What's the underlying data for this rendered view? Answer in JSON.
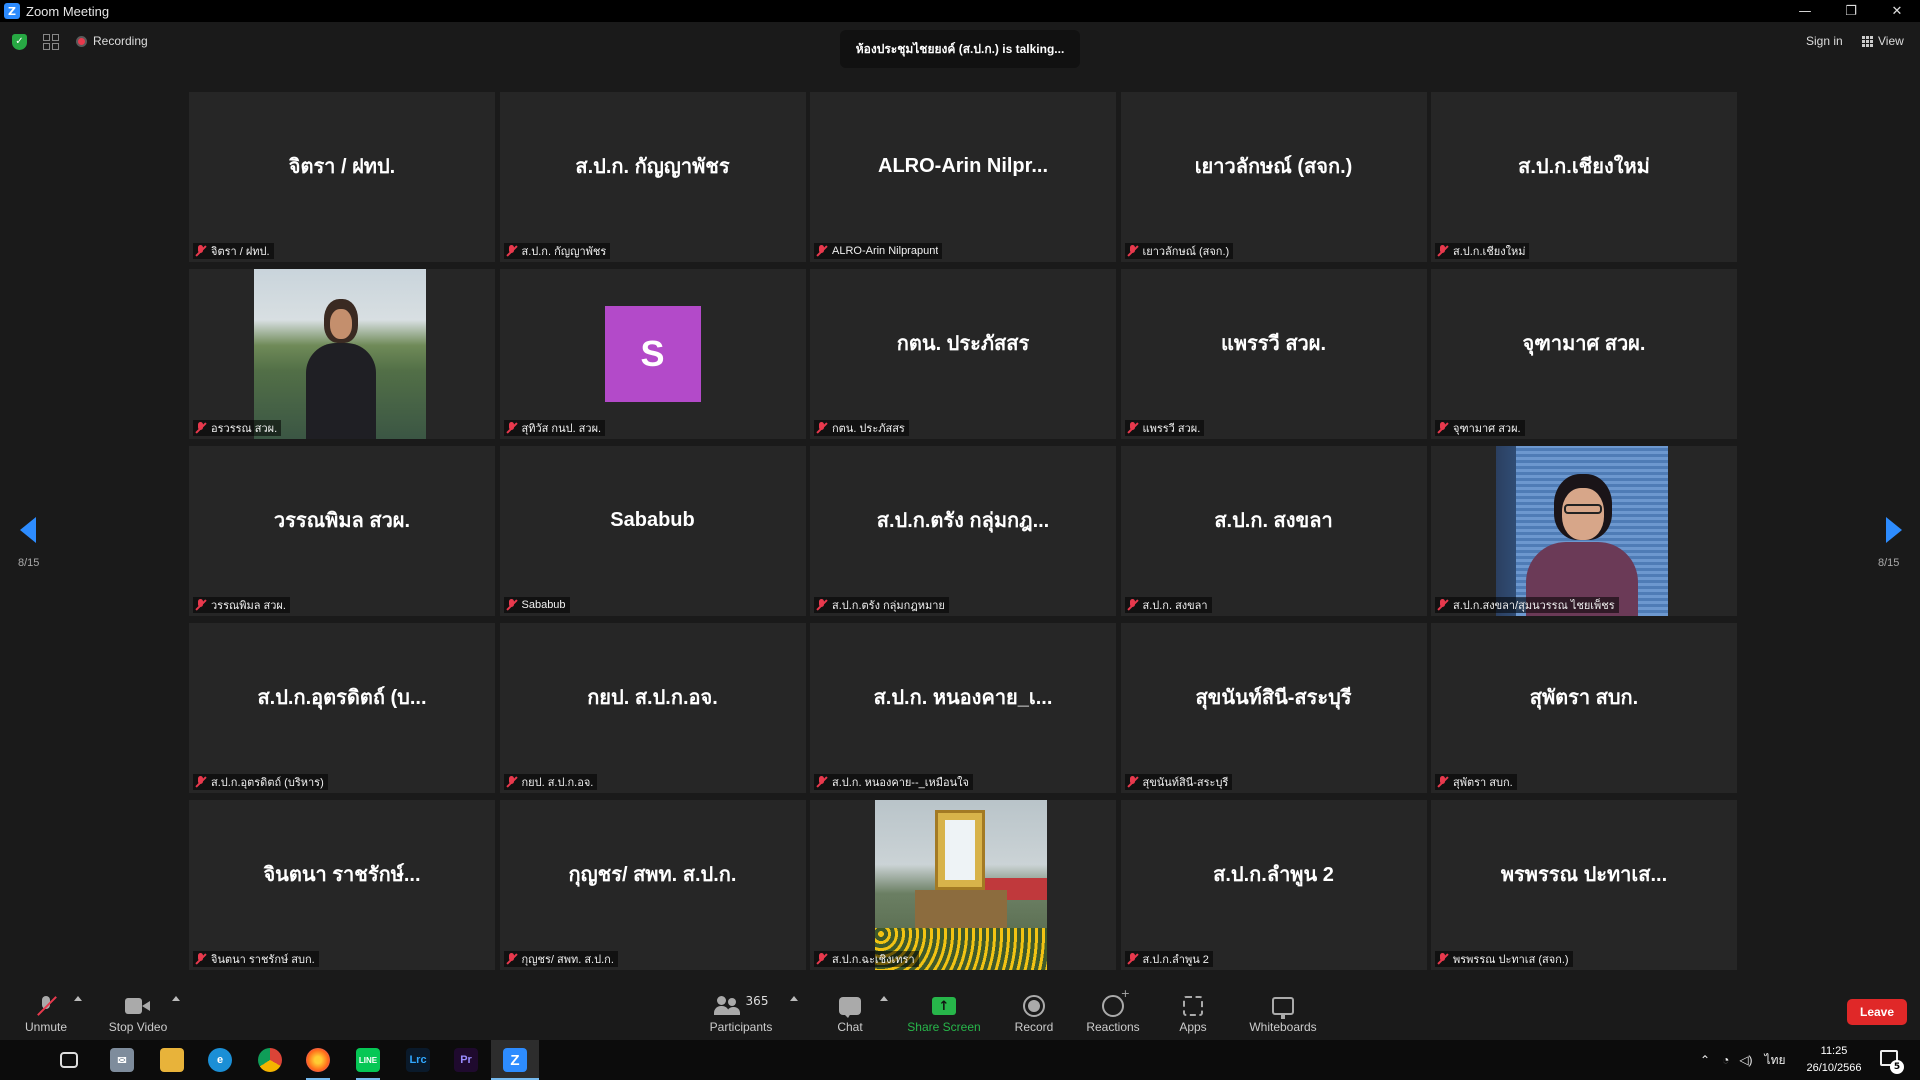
{
  "window": {
    "title": "Zoom Meeting",
    "min": "—",
    "restore": "❐",
    "close": "✕"
  },
  "topbar": {
    "recording": "Recording",
    "talking": "ห้องประชุมไชยยงค์ (ส.ป.ก.) is  talking...",
    "signin": "Sign in",
    "view": "View"
  },
  "gallery": {
    "page_left": "8/15",
    "page_right": "8/15",
    "tiles": [
      {
        "big": "จิตรา / ฝทป.",
        "name": "จิตรา / ฝทป."
      },
      {
        "big": "ส.ป.ก. กัญญาพัชร",
        "name": "ส.ป.ก. กัญญาพัชร"
      },
      {
        "big": "ALRO-Arin  Nilpr...",
        "name": "ALRO-Arin Nilprapunt"
      },
      {
        "big": "เยาวลักษณ์ (สจก.)",
        "name": "เยาวลักษณ์ (สจก.)"
      },
      {
        "big": "ส.ป.ก.เชียงใหม่",
        "name": "ส.ป.ก.เชียงใหม่"
      },
      {
        "big": "",
        "name": "อรวรรณ สวผ."
      },
      {
        "big": "",
        "avatar": "S",
        "name": "สุทิวัส กนป. สวผ."
      },
      {
        "big": "กตน. ประภัสสร",
        "name": "กตน. ประภัสสร"
      },
      {
        "big": "แพรรวี สวผ.",
        "name": "แพรรวี สวผ."
      },
      {
        "big": "จุฑามาศ สวผ.",
        "name": "จุฑามาศ สวผ."
      },
      {
        "big": "วรรณพิมล สวผ.",
        "name": "วรรณพิมล สวผ."
      },
      {
        "big": "Sababub",
        "name": "Sababub"
      },
      {
        "big": "ส.ป.ก.ตรัง กลุ่มกฎ...",
        "name": "ส.ป.ก.ตรัง กลุ่มกฎหมาย"
      },
      {
        "big": "ส.ป.ก. สงขลา",
        "name": "ส.ป.ก. สงขลา"
      },
      {
        "big": "",
        "name": "ส.ป.ก.สงขลา/สุมนวรรณ ไชยเพ็ชร"
      },
      {
        "big": "ส.ป.ก.อุตรดิตถ์ (บ...",
        "name": "ส.ป.ก.อุตรดิตถ์ (บริหาร)"
      },
      {
        "big": "กยป. ส.ป.ก.อจ.",
        "name": "กยป. ส.ป.ก.อจ."
      },
      {
        "big": "ส.ป.ก. หนองคาย_เ...",
        "name": "ส.ป.ก. หนองคาย--_เหมือนใจ"
      },
      {
        "big": "สุขนันท์สินี-สระบุรี",
        "name": "สุขนันท์สินี-สระบุรี"
      },
      {
        "big": "สุพัตรา สบก.",
        "name": "สุพัตรา สบก."
      },
      {
        "big": "จินตนา  ราชรักษ์...",
        "name": "จินตนา  ราชรักษ์ สบก."
      },
      {
        "big": "กุญชร/ สพท. ส.ป.ก.",
        "name": "กุญชร/ สพท. ส.ป.ก."
      },
      {
        "big": "",
        "name": "ส.ป.ก.ฉะเชิงเทรา"
      },
      {
        "big": "ส.ป.ก.ลำพูน 2",
        "name": "ส.ป.ก.ลำพูน 2"
      },
      {
        "big": "พรพรรณ ปะทาเส...",
        "name": "พรพรรณ ปะทาเส (สจก.)"
      }
    ]
  },
  "toolbar": {
    "unmute": "Unmute",
    "stop_video": "Stop Video",
    "participants": "Participants",
    "participants_count": "365",
    "chat": "Chat",
    "share_screen": "Share Screen",
    "record": "Record",
    "reactions": "Reactions",
    "apps": "Apps",
    "whiteboards": "Whiteboards",
    "leave": "Leave"
  },
  "taskbar": {
    "time": "11:25",
    "date": "26/10/2566",
    "lang": "ไทย",
    "notif_count": "5",
    "apps": [
      "windows-start",
      "task-view",
      "mail",
      "file-explorer",
      "edge",
      "chrome",
      "firefox",
      "line",
      "lightroom",
      "premiere",
      "zoom"
    ]
  },
  "colors": {
    "accent": "#2d8cff",
    "muted_mic": "#e8394d",
    "leave": "#e02828",
    "share": "#27b64a"
  }
}
